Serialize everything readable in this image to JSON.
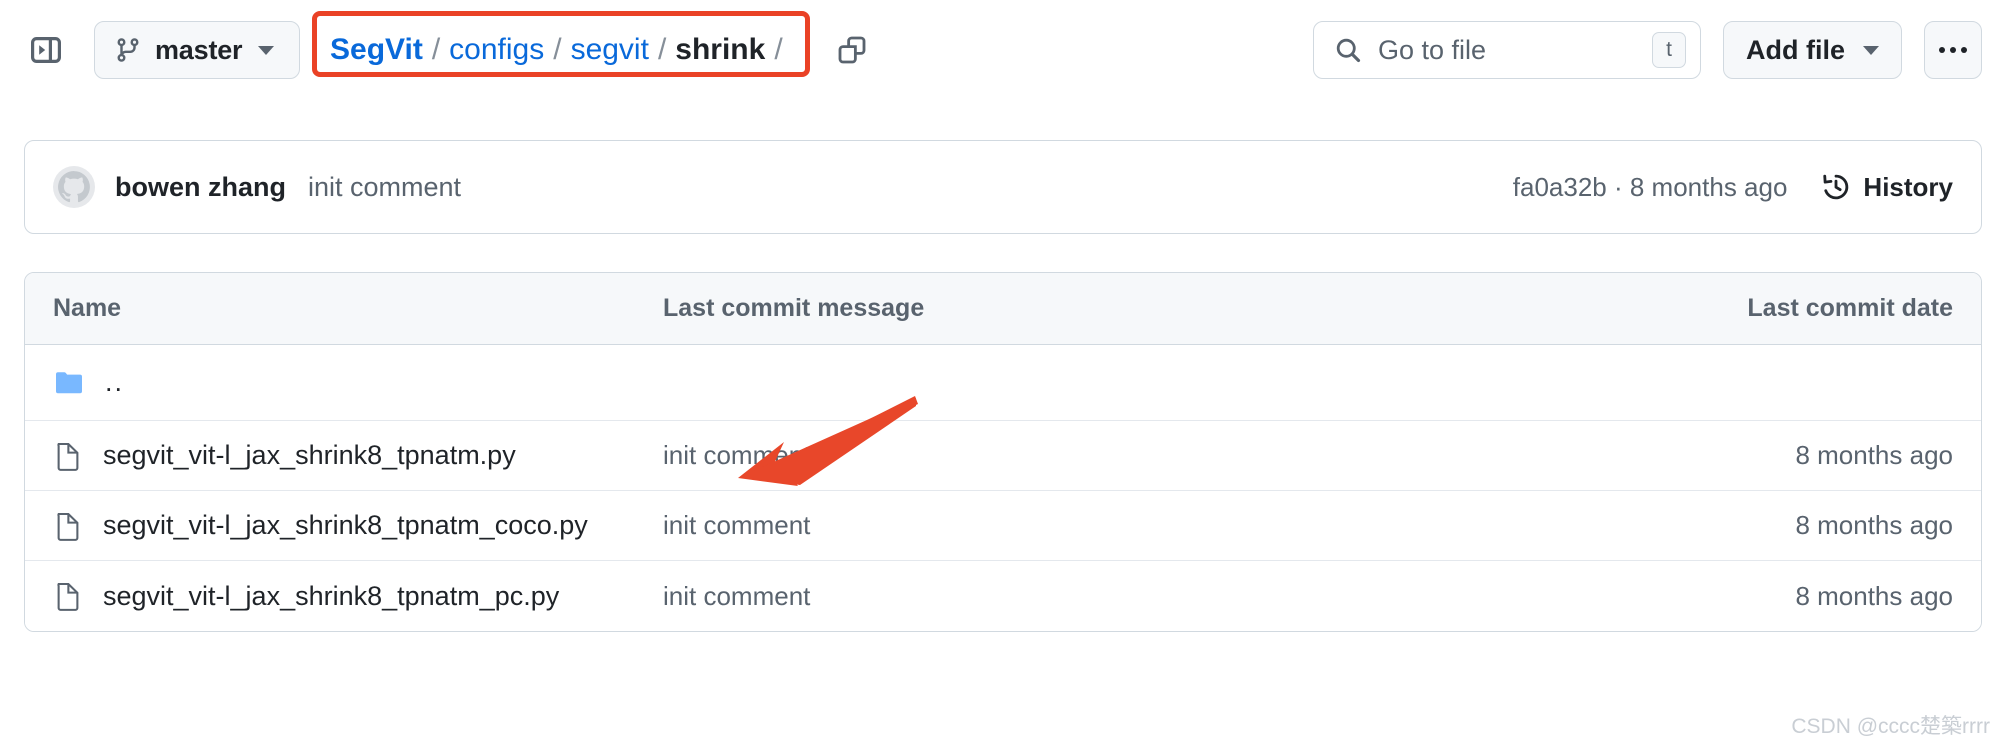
{
  "header": {
    "sidebar_toggle_name": "Expand file tree",
    "branch": {
      "label": "master"
    },
    "breadcrumb": [
      {
        "text": "SegVit",
        "type": "link-bold"
      },
      {
        "text": "configs",
        "type": "link"
      },
      {
        "text": "segvit",
        "type": "link"
      },
      {
        "text": "shrink",
        "type": "current"
      }
    ],
    "breadcrumb_separator": "/",
    "copy_path_title": "Copy path",
    "search": {
      "placeholder": "Go to file",
      "shortcut": "t"
    },
    "add_file": {
      "label": "Add file"
    },
    "more_menu_title": "More options"
  },
  "commit_bar": {
    "author": "bowen zhang",
    "message": "init comment",
    "sha": "fa0a32b",
    "separator": "·",
    "relative_time": "8 months ago",
    "meta": "fa0a32b · 8 months ago",
    "history_label": "History"
  },
  "table": {
    "headers": {
      "name": "Name",
      "message": "Last commit message",
      "date": "Last commit date"
    },
    "rows": [
      {
        "kind": "directory",
        "icon": "folder-icon",
        "name": "..",
        "message": "",
        "date": ""
      },
      {
        "kind": "file",
        "icon": "file-icon",
        "name": "segvit_vit-l_jax_shrink8_tpnatm.py",
        "message": "init comment",
        "date": "8 months ago"
      },
      {
        "kind": "file",
        "icon": "file-icon",
        "name": "segvit_vit-l_jax_shrink8_tpnatm_coco.py",
        "message": "init comment",
        "date": "8 months ago"
      },
      {
        "kind": "file",
        "icon": "file-icon",
        "name": "segvit_vit-l_jax_shrink8_tpnatm_pc.py",
        "message": "init comment",
        "date": "8 months ago"
      }
    ]
  },
  "annotations": {
    "highlight_color": "#ea4226",
    "arrow_color": "#e8472a",
    "highlight_target": "breadcrumb",
    "arrow_target": "segvit_vit-l_jax_shrink8_tpnatm_coco.py"
  },
  "watermark": {
    "text": "CSDN @cccc楚築rrrr"
  },
  "colors": {
    "link": "#0969da",
    "text": "#1f2328",
    "muted": "#59636e",
    "border": "#d1d9e0",
    "surface": "#f6f8fa",
    "folder": "#79b8ff"
  }
}
